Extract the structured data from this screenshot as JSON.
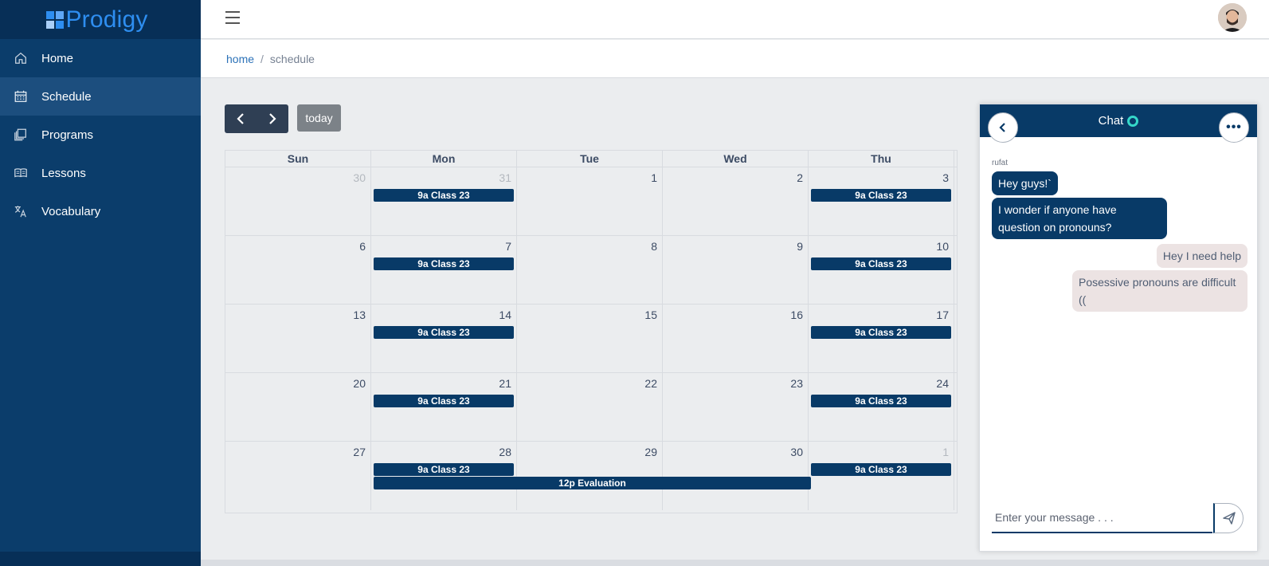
{
  "brand": {
    "name": "Prodigy"
  },
  "sidebar": {
    "items": [
      {
        "label": "Home",
        "icon": "home-icon"
      },
      {
        "label": "Schedule",
        "icon": "calendar-icon",
        "active": true
      },
      {
        "label": "Programs",
        "icon": "programs-icon"
      },
      {
        "label": "Lessons",
        "icon": "book-icon"
      },
      {
        "label": "Vocabulary",
        "icon": "translate-icon"
      }
    ]
  },
  "breadcrumb": {
    "home": "home",
    "separator": "/",
    "current": "schedule"
  },
  "toolbar": {
    "today_label": "today"
  },
  "calendar": {
    "weekdays": [
      "Sun",
      "Mon",
      "Tue",
      "Wed",
      "Thu"
    ],
    "weeks": [
      {
        "days": [
          "30",
          "31",
          "1",
          "2",
          "3"
        ],
        "other": [
          true,
          true,
          false,
          false,
          false
        ]
      },
      {
        "days": [
          "6",
          "7",
          "8",
          "9",
          "10"
        ],
        "other": [
          false,
          false,
          false,
          false,
          false
        ]
      },
      {
        "days": [
          "13",
          "14",
          "15",
          "16",
          "17"
        ],
        "other": [
          false,
          false,
          false,
          false,
          false
        ]
      },
      {
        "days": [
          "20",
          "21",
          "22",
          "23",
          "24"
        ],
        "other": [
          false,
          false,
          false,
          false,
          false
        ]
      },
      {
        "days": [
          "27",
          "28",
          "29",
          "30",
          "1"
        ],
        "other": [
          false,
          false,
          false,
          false,
          true
        ]
      }
    ],
    "event_label": "9a Class 23",
    "span_event_label": "12p Evaluation"
  },
  "chat": {
    "title": "Chat",
    "sender": "rufat",
    "messages": [
      {
        "text": "Hey guys!`",
        "dir": "in"
      },
      {
        "text": "I wonder if anyone have question on pronouns?",
        "dir": "in"
      },
      {
        "text": "Hey I need help",
        "dir": "out"
      },
      {
        "text": "Posessive pronouns are difficult ((",
        "dir": "out"
      }
    ],
    "input_placeholder": "Enter your message . . .",
    "more_label": "•••"
  },
  "colors": {
    "primary": "#083a67",
    "sidebar": "#0b3d6b",
    "accent": "#2e8ef0",
    "status": "#35d7c9"
  }
}
